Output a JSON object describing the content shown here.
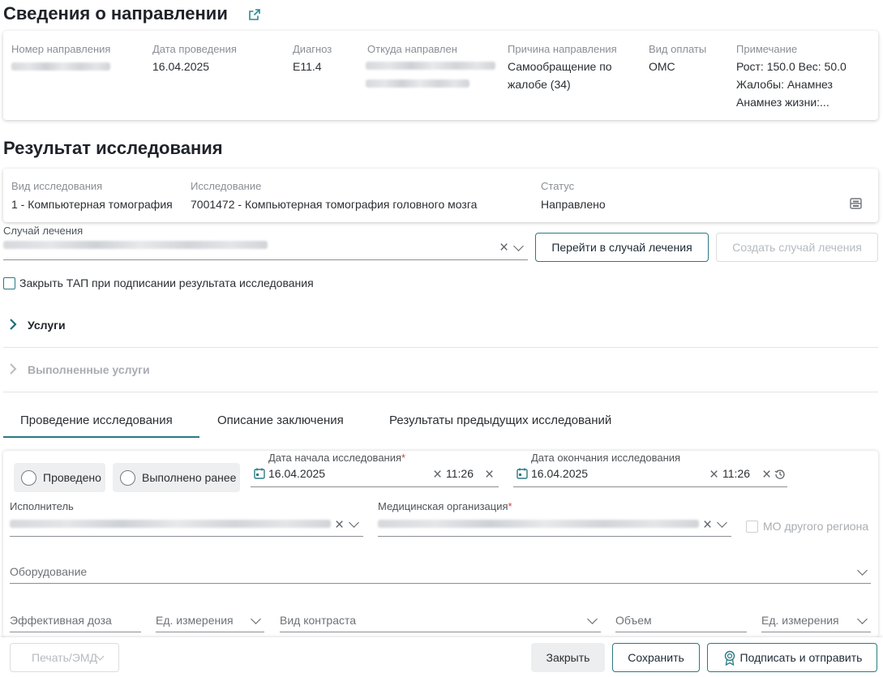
{
  "referral": {
    "title": "Сведения о направлении",
    "fields": {
      "number_label": "Номер направления",
      "date_label": "Дата проведения",
      "date_value": "16.04.2025",
      "diagnosis_label": "Диагноз",
      "diagnosis_value": "E11.4",
      "from_label": "Откуда направлен",
      "reason_label": "Причина направления",
      "reason_value": "Самообращение по жалобе (34)",
      "payment_label": "Вид оплаты",
      "payment_value": "ОМС",
      "note_label": "Примечание",
      "note_line1": "Рост: 150.0 Вес: 50.0",
      "note_line2": "Жалобы: Анамнез",
      "note_line3": "Анамнез жизни:..."
    }
  },
  "result": {
    "title": "Результат исследования",
    "type_label": "Вид исследования",
    "type_value": "1 - Компьютерная томография",
    "study_label": "Исследование",
    "study_value": "7001472 - Компьютерная томография головного мозга",
    "status_label": "Статус",
    "status_value": "Направлено"
  },
  "case": {
    "label": "Случай лечения",
    "go_button": "Перейти в случай лечения",
    "create_button": "Создать случай лечения",
    "close_tap_label": "Закрыть ТАП при подписании результата исследования"
  },
  "sections": {
    "services": "Услуги",
    "done_services": "Выполненные услуги"
  },
  "tabs": [
    {
      "label": "Проведение исследования",
      "active": true
    },
    {
      "label": "Описание заключения",
      "active": false
    },
    {
      "label": "Результаты предыдущих исследований",
      "active": false
    }
  ],
  "form": {
    "radio_done": "Проведено",
    "radio_earlier": "Выполнено ранее",
    "start_label": "Дата начала исследования",
    "start_date": "16.04.2025",
    "start_time": "11:26",
    "end_label": "Дата окончания исследования",
    "end_date": "16.04.2025",
    "end_time": "11:26",
    "executor_label": "Исполнитель",
    "org_label": "Медицинская организация",
    "other_region_label": "МО другого региона",
    "equipment_label": "Оборудование",
    "dose_label": "Эффективная доза",
    "unit_label": "Ед. измерения",
    "contrast_label": "Вид контраста",
    "volume_label": "Объем",
    "unit2_label": "Ед. измерения",
    "required_mark": "*"
  },
  "footer": {
    "print_button": "Печать/ЭМД",
    "close_button": "Закрыть",
    "save_button": "Сохранить",
    "sign_button": "Подписать и отправить"
  },
  "colors": {
    "accent": "#2a7a82",
    "required": "#d6453d",
    "active_tab_underline": "#2a7a82"
  }
}
